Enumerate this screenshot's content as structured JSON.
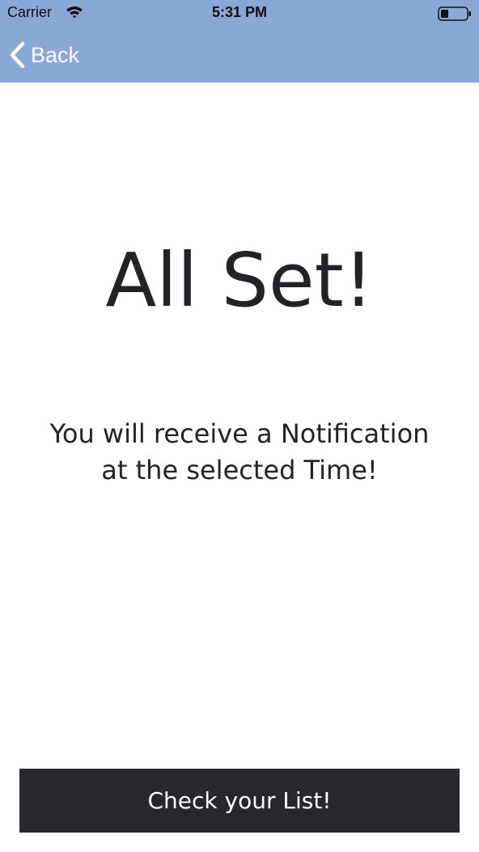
{
  "status_bar": {
    "carrier": "Carrier",
    "time": "5:31 PM",
    "wifi_icon": "wifi-icon",
    "battery_icon": "battery-icon"
  },
  "nav": {
    "back_label": "Back",
    "back_icon": "chevron-left-icon"
  },
  "content": {
    "title": "All Set!",
    "message_line1": "You will receive a Notification",
    "message_line2": "at the selected Time!"
  },
  "cta": {
    "label": "Check your List!"
  },
  "colors": {
    "header_background": "#89a8d6",
    "button_background": "#27272c",
    "text": "#222227"
  }
}
